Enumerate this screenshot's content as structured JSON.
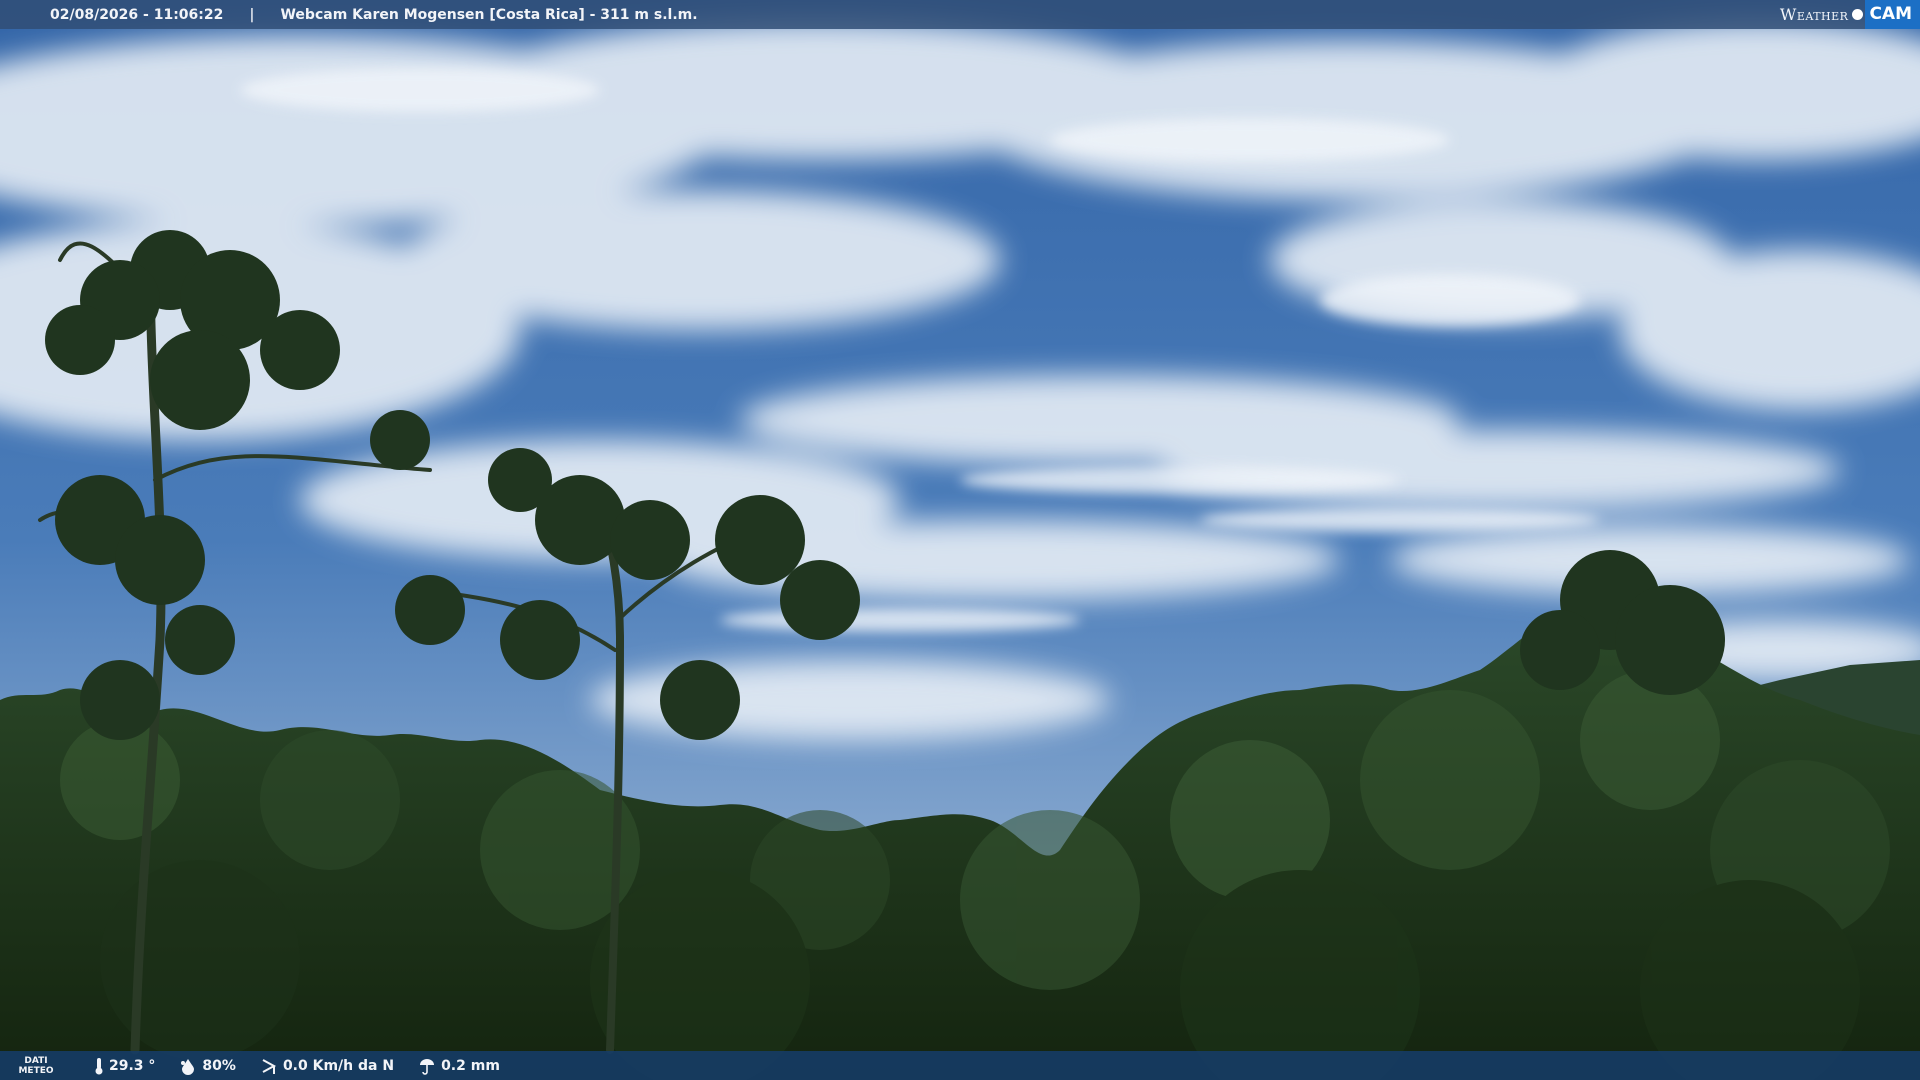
{
  "header": {
    "datetime": "02/08/2026 - 11:06:22",
    "separator": "|",
    "webcam_title": "Webcam Karen Mogensen [Costa Rica] - 311 m s.l.m."
  },
  "logo": {
    "weather": "Weather",
    "cam": "CAM"
  },
  "footer": {
    "label_line1": "DATI",
    "label_line2": "METEO",
    "temperature": "29.3 °",
    "humidity": "80%",
    "wind": "0.0 Km/h da N",
    "rain": "0.2 mm",
    "icons": [
      "thermometer-icon",
      "humidity-icon",
      "wind-icon",
      "rain-icon"
    ]
  },
  "colors": {
    "sky": "#3c6fae",
    "cloud": "#e3ebf4",
    "forest": "#1e3a1d",
    "bar_top": "#304e76",
    "bar_bottom": "#163c68",
    "logo_accent": "#1c6fc5"
  }
}
